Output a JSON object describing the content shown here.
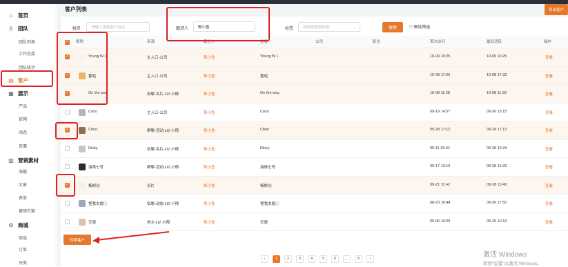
{
  "nav": {
    "groups": [
      {
        "label": "首页",
        "icon": "home-icon",
        "glyph": "⌂"
      },
      {
        "label": "团队",
        "icon": "team-icon",
        "glyph": "♙"
      },
      {
        "label": "客户",
        "icon": "customer-icon",
        "glyph": "▤"
      },
      {
        "label": "展示",
        "icon": "display-icon",
        "glyph": "▦"
      },
      {
        "label": "营销素材",
        "icon": "material-icon",
        "glyph": "▥"
      },
      {
        "label": "商城",
        "icon": "mall-icon",
        "glyph": "⚙"
      }
    ],
    "items": [
      "团队列表",
      "工作交接",
      "团队统计",
      "产品",
      "官网",
      "动态",
      "页面",
      "海报",
      "文章",
      "表单",
      "营销方案",
      "商品",
      "订单",
      "分类"
    ]
  },
  "page": {
    "title": "客户列表",
    "export_label": "导出客户",
    "transfer_label": "转移客户"
  },
  "filters": {
    "name_label": "姓名",
    "name_placeholder": "请输入搜索客户姓名",
    "follower_label": "跟进人",
    "follower_value": "郁小鱼",
    "tag_label": "标签",
    "tag_placeholder": "请选择搜索标签",
    "search_label": "搜索",
    "advanced_label": "高级筛选"
  },
  "table": {
    "columns": [
      "昵称",
      "来源",
      "跟进人",
      "姓名",
      "公司",
      "职位",
      "首次访问",
      "最后活跃",
      "操作"
    ],
    "rows": [
      {
        "checked": true,
        "nick": "Young W L",
        "source": "主入口-公司",
        "follower": "郁小鱼",
        "name": "Young W L",
        "company": "",
        "position": "",
        "first": "10-09 10:25",
        "last": "10-09 10:25",
        "action": "查看",
        "avatar": "#f3f3f3"
      },
      {
        "checked": true,
        "nick": "蓄昭",
        "source": "主入口-公司",
        "follower": "郁小鱼",
        "name": "蓄昭",
        "company": "",
        "position": "",
        "first": "10-08 17:26",
        "last": "10-08 17:33",
        "action": "查看",
        "avatar": "#e8b86a"
      },
      {
        "checked": true,
        "nick": "On the way",
        "source": "私聊-名片-LIZ 小郁",
        "follower": "郁小鱼",
        "name": "On the way",
        "company": "",
        "position": "",
        "first": "10-08 11:28",
        "last": "10-08 11:29",
        "action": "查看",
        "avatar": "#f7f7f7"
      },
      {
        "checked": false,
        "nick": "Coco",
        "source": "主入口-公司",
        "follower": "郁小鱼",
        "name": "Coco",
        "company": "",
        "position": "",
        "first": "09-19 14:57",
        "last": "09-30 15:15",
        "action": "查看",
        "avatar": "#b5b5b5"
      },
      {
        "checked": true,
        "nick": "Choo",
        "source": "群聊-活动-LIZ 小郁",
        "follower": "郁小鱼",
        "name": "Choo",
        "company": "",
        "position": "",
        "first": "09-28 17:12",
        "last": "09-28 17:13",
        "action": "查看",
        "avatar": "#8a7355"
      },
      {
        "checked": false,
        "nick": "Dicky",
        "source": "私聊-名片-LIZ 小郁",
        "follower": "郁小鱼",
        "name": "Dicky",
        "company": "",
        "position": "",
        "first": "09-11 15:41",
        "last": "09-28 16:34",
        "action": "查看",
        "avatar": "#c6c6c6"
      },
      {
        "checked": false,
        "nick": "海角七号",
        "source": "群聊-活动-LIZ 小郁",
        "follower": "郁小鱼",
        "name": "海角七号",
        "company": "",
        "position": "",
        "first": "09-17 13:19",
        "last": "09-28 16:33",
        "action": "查看",
        "avatar": "#2c2c2c"
      },
      {
        "checked": true,
        "nick": "杨柳😊",
        "source": "名片",
        "follower": "郁小鱼",
        "name": "杨柳😊",
        "company": "",
        "position": "",
        "first": "09-21 11:42",
        "last": "09-28 13:40",
        "action": "查看",
        "avatar": "#f0f0f0"
      },
      {
        "checked": false,
        "nick": "怪我太倔ⓒ",
        "source": "私聊-动态-LIZ 小郁",
        "follower": "郁小鱼",
        "name": "怪我太倔ⓒ",
        "company": "",
        "position": "",
        "first": "08-23 16:44",
        "last": "09-26 17:50",
        "action": "查看",
        "avatar": "#9aa8b8"
      },
      {
        "checked": false,
        "nick": "天使",
        "source": "热文-LIZ 小郁",
        "follower": "郁小鱼",
        "name": "天使",
        "company": "",
        "position": "",
        "first": "09-06 10:29",
        "last": "09-26 10:19",
        "action": "查看",
        "avatar": "#d8c2b0"
      }
    ]
  },
  "pagination": {
    "prev": "‹",
    "pages": [
      "1",
      "2",
      "3",
      "4",
      "5",
      "6",
      "…",
      "8"
    ],
    "next": "›"
  },
  "watermark": {
    "line1": "激活 Windows",
    "line2": "转到\"设置\"以激活 Windows。"
  },
  "colors": {
    "accent": "#e6772b",
    "annotation": "#e02020"
  }
}
